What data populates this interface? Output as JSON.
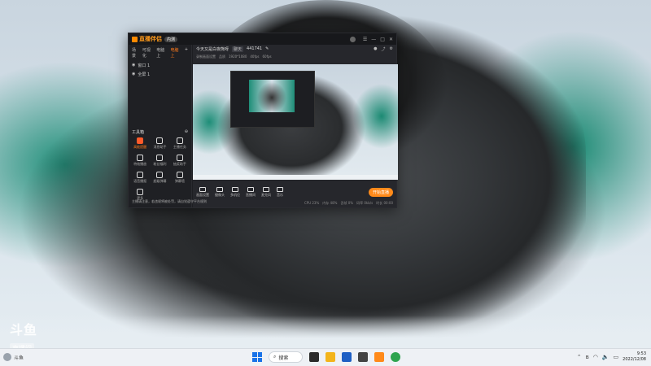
{
  "desktop": {
    "watermark": {
      "logo": "斗鱼",
      "sub": "直播间"
    }
  },
  "app": {
    "title": "直播伴侣",
    "badge": "内测",
    "scene_tabs": [
      "场景",
      "可视化",
      "电脑上",
      "电脑上"
    ],
    "sources": [
      "窗口 1",
      "全屏 1"
    ],
    "room_title": "今天又是白夜熊呀",
    "room_tag": "聊天",
    "room_id": "441741",
    "room_row2": [
      "录制画面设置",
      "品质",
      "1920*1080",
      "40fps",
      "60fps"
    ],
    "tools_title": "工具箱",
    "tools": [
      {
        "label": "高能提醒",
        "hot": true
      },
      {
        "label": "消息助手",
        "hot": false
      },
      {
        "label": "主播任务",
        "hot": false
      },
      {
        "label": "特效播放",
        "hot": false
      },
      {
        "label": "粉丝福利",
        "hot": false
      },
      {
        "label": "抽奖助手",
        "hot": false
      },
      {
        "label": "语音播报",
        "hot": false
      },
      {
        "label": "超级弹幕",
        "hot": false
      },
      {
        "label": "弹幕墙",
        "hot": false
      },
      {
        "label": "更多",
        "hot": false
      }
    ],
    "bottom_tools": [
      "画面设置",
      "摄像头",
      "多机位",
      "直播间",
      "麦克风",
      "音乐"
    ],
    "start_button": "开始直播",
    "notice": "主播请注意，若违规将被处罚，请自觉遵守平台规则",
    "status": [
      "CPU 23%",
      "内存 48%",
      "丢帧 0%",
      "码率 0kb/s",
      "时长 00:00"
    ]
  },
  "taskbar": {
    "search_label": "搜索",
    "time": "9:53",
    "date": "2022/12/08",
    "left_status": "斗鱼"
  }
}
